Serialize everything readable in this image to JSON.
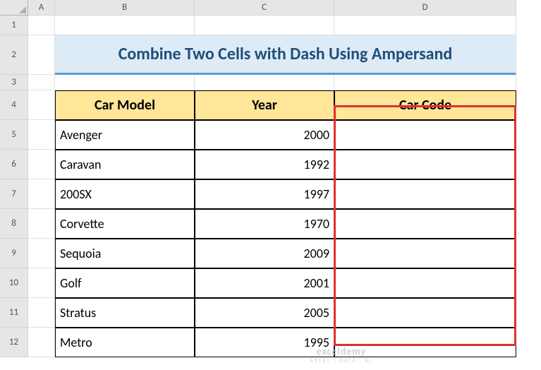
{
  "columns": [
    "A",
    "B",
    "C",
    "D"
  ],
  "rows": [
    "1",
    "2",
    "3",
    "4",
    "5",
    "6",
    "7",
    "8",
    "9",
    "10",
    "11",
    "12"
  ],
  "title": "Combine Two Cells with Dash Using Ampersand",
  "headers": {
    "model": "Car Model",
    "year": "Year",
    "code": "Car Code"
  },
  "data": [
    {
      "model": "Avenger",
      "year": "2000",
      "code": ""
    },
    {
      "model": "Caravan",
      "year": "1992",
      "code": ""
    },
    {
      "model": "200SX",
      "year": "1997",
      "code": ""
    },
    {
      "model": "Corvette",
      "year": "1970",
      "code": ""
    },
    {
      "model": "Sequoia",
      "year": "2009",
      "code": ""
    },
    {
      "model": "Golf",
      "year": "2001",
      "code": ""
    },
    {
      "model": "Stratus",
      "year": "2005",
      "code": ""
    },
    {
      "model": "Metro",
      "year": "1995",
      "code": ""
    }
  ],
  "watermark": {
    "main": "exceldemy",
    "sub": "EXCEL · DATA · BI"
  },
  "chart_data": {
    "type": "table",
    "title": "Combine Two Cells with Dash Using Ampersand",
    "columns": [
      "Car Model",
      "Year",
      "Car Code"
    ],
    "rows": [
      [
        "Avenger",
        2000,
        ""
      ],
      [
        "Caravan",
        1992,
        ""
      ],
      [
        "200SX",
        1997,
        ""
      ],
      [
        "Corvette",
        1970,
        ""
      ],
      [
        "Sequoia",
        2009,
        ""
      ],
      [
        "Golf",
        2001,
        ""
      ],
      [
        "Stratus",
        2005,
        ""
      ],
      [
        "Metro",
        1995,
        ""
      ]
    ]
  }
}
